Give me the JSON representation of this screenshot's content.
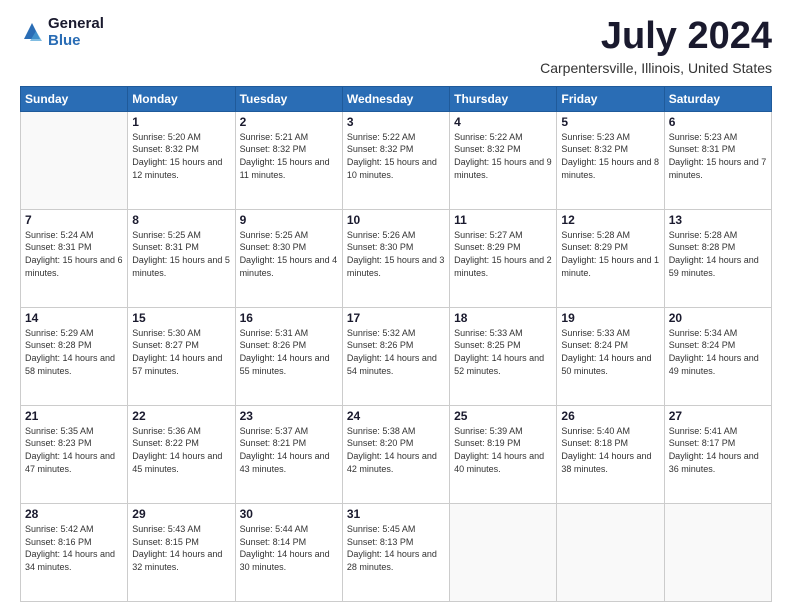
{
  "logo": {
    "general": "General",
    "blue": "Blue"
  },
  "title": "July 2024",
  "location": "Carpentersville, Illinois, United States",
  "days_of_week": [
    "Sunday",
    "Monday",
    "Tuesday",
    "Wednesday",
    "Thursday",
    "Friday",
    "Saturday"
  ],
  "weeks": [
    [
      {
        "day": "",
        "sunrise": "",
        "sunset": "",
        "daylight": ""
      },
      {
        "day": "1",
        "sunrise": "Sunrise: 5:20 AM",
        "sunset": "Sunset: 8:32 PM",
        "daylight": "Daylight: 15 hours and 12 minutes."
      },
      {
        "day": "2",
        "sunrise": "Sunrise: 5:21 AM",
        "sunset": "Sunset: 8:32 PM",
        "daylight": "Daylight: 15 hours and 11 minutes."
      },
      {
        "day": "3",
        "sunrise": "Sunrise: 5:22 AM",
        "sunset": "Sunset: 8:32 PM",
        "daylight": "Daylight: 15 hours and 10 minutes."
      },
      {
        "day": "4",
        "sunrise": "Sunrise: 5:22 AM",
        "sunset": "Sunset: 8:32 PM",
        "daylight": "Daylight: 15 hours and 9 minutes."
      },
      {
        "day": "5",
        "sunrise": "Sunrise: 5:23 AM",
        "sunset": "Sunset: 8:32 PM",
        "daylight": "Daylight: 15 hours and 8 minutes."
      },
      {
        "day": "6",
        "sunrise": "Sunrise: 5:23 AM",
        "sunset": "Sunset: 8:31 PM",
        "daylight": "Daylight: 15 hours and 7 minutes."
      }
    ],
    [
      {
        "day": "7",
        "sunrise": "Sunrise: 5:24 AM",
        "sunset": "Sunset: 8:31 PM",
        "daylight": "Daylight: 15 hours and 6 minutes."
      },
      {
        "day": "8",
        "sunrise": "Sunrise: 5:25 AM",
        "sunset": "Sunset: 8:31 PM",
        "daylight": "Daylight: 15 hours and 5 minutes."
      },
      {
        "day": "9",
        "sunrise": "Sunrise: 5:25 AM",
        "sunset": "Sunset: 8:30 PM",
        "daylight": "Daylight: 15 hours and 4 minutes."
      },
      {
        "day": "10",
        "sunrise": "Sunrise: 5:26 AM",
        "sunset": "Sunset: 8:30 PM",
        "daylight": "Daylight: 15 hours and 3 minutes."
      },
      {
        "day": "11",
        "sunrise": "Sunrise: 5:27 AM",
        "sunset": "Sunset: 8:29 PM",
        "daylight": "Daylight: 15 hours and 2 minutes."
      },
      {
        "day": "12",
        "sunrise": "Sunrise: 5:28 AM",
        "sunset": "Sunset: 8:29 PM",
        "daylight": "Daylight: 15 hours and 1 minute."
      },
      {
        "day": "13",
        "sunrise": "Sunrise: 5:28 AM",
        "sunset": "Sunset: 8:28 PM",
        "daylight": "Daylight: 14 hours and 59 minutes."
      }
    ],
    [
      {
        "day": "14",
        "sunrise": "Sunrise: 5:29 AM",
        "sunset": "Sunset: 8:28 PM",
        "daylight": "Daylight: 14 hours and 58 minutes."
      },
      {
        "day": "15",
        "sunrise": "Sunrise: 5:30 AM",
        "sunset": "Sunset: 8:27 PM",
        "daylight": "Daylight: 14 hours and 57 minutes."
      },
      {
        "day": "16",
        "sunrise": "Sunrise: 5:31 AM",
        "sunset": "Sunset: 8:26 PM",
        "daylight": "Daylight: 14 hours and 55 minutes."
      },
      {
        "day": "17",
        "sunrise": "Sunrise: 5:32 AM",
        "sunset": "Sunset: 8:26 PM",
        "daylight": "Daylight: 14 hours and 54 minutes."
      },
      {
        "day": "18",
        "sunrise": "Sunrise: 5:33 AM",
        "sunset": "Sunset: 8:25 PM",
        "daylight": "Daylight: 14 hours and 52 minutes."
      },
      {
        "day": "19",
        "sunrise": "Sunrise: 5:33 AM",
        "sunset": "Sunset: 8:24 PM",
        "daylight": "Daylight: 14 hours and 50 minutes."
      },
      {
        "day": "20",
        "sunrise": "Sunrise: 5:34 AM",
        "sunset": "Sunset: 8:24 PM",
        "daylight": "Daylight: 14 hours and 49 minutes."
      }
    ],
    [
      {
        "day": "21",
        "sunrise": "Sunrise: 5:35 AM",
        "sunset": "Sunset: 8:23 PM",
        "daylight": "Daylight: 14 hours and 47 minutes."
      },
      {
        "day": "22",
        "sunrise": "Sunrise: 5:36 AM",
        "sunset": "Sunset: 8:22 PM",
        "daylight": "Daylight: 14 hours and 45 minutes."
      },
      {
        "day": "23",
        "sunrise": "Sunrise: 5:37 AM",
        "sunset": "Sunset: 8:21 PM",
        "daylight": "Daylight: 14 hours and 43 minutes."
      },
      {
        "day": "24",
        "sunrise": "Sunrise: 5:38 AM",
        "sunset": "Sunset: 8:20 PM",
        "daylight": "Daylight: 14 hours and 42 minutes."
      },
      {
        "day": "25",
        "sunrise": "Sunrise: 5:39 AM",
        "sunset": "Sunset: 8:19 PM",
        "daylight": "Daylight: 14 hours and 40 minutes."
      },
      {
        "day": "26",
        "sunrise": "Sunrise: 5:40 AM",
        "sunset": "Sunset: 8:18 PM",
        "daylight": "Daylight: 14 hours and 38 minutes."
      },
      {
        "day": "27",
        "sunrise": "Sunrise: 5:41 AM",
        "sunset": "Sunset: 8:17 PM",
        "daylight": "Daylight: 14 hours and 36 minutes."
      }
    ],
    [
      {
        "day": "28",
        "sunrise": "Sunrise: 5:42 AM",
        "sunset": "Sunset: 8:16 PM",
        "daylight": "Daylight: 14 hours and 34 minutes."
      },
      {
        "day": "29",
        "sunrise": "Sunrise: 5:43 AM",
        "sunset": "Sunset: 8:15 PM",
        "daylight": "Daylight: 14 hours and 32 minutes."
      },
      {
        "day": "30",
        "sunrise": "Sunrise: 5:44 AM",
        "sunset": "Sunset: 8:14 PM",
        "daylight": "Daylight: 14 hours and 30 minutes."
      },
      {
        "day": "31",
        "sunrise": "Sunrise: 5:45 AM",
        "sunset": "Sunset: 8:13 PM",
        "daylight": "Daylight: 14 hours and 28 minutes."
      },
      {
        "day": "",
        "sunrise": "",
        "sunset": "",
        "daylight": ""
      },
      {
        "day": "",
        "sunrise": "",
        "sunset": "",
        "daylight": ""
      },
      {
        "day": "",
        "sunrise": "",
        "sunset": "",
        "daylight": ""
      }
    ]
  ]
}
